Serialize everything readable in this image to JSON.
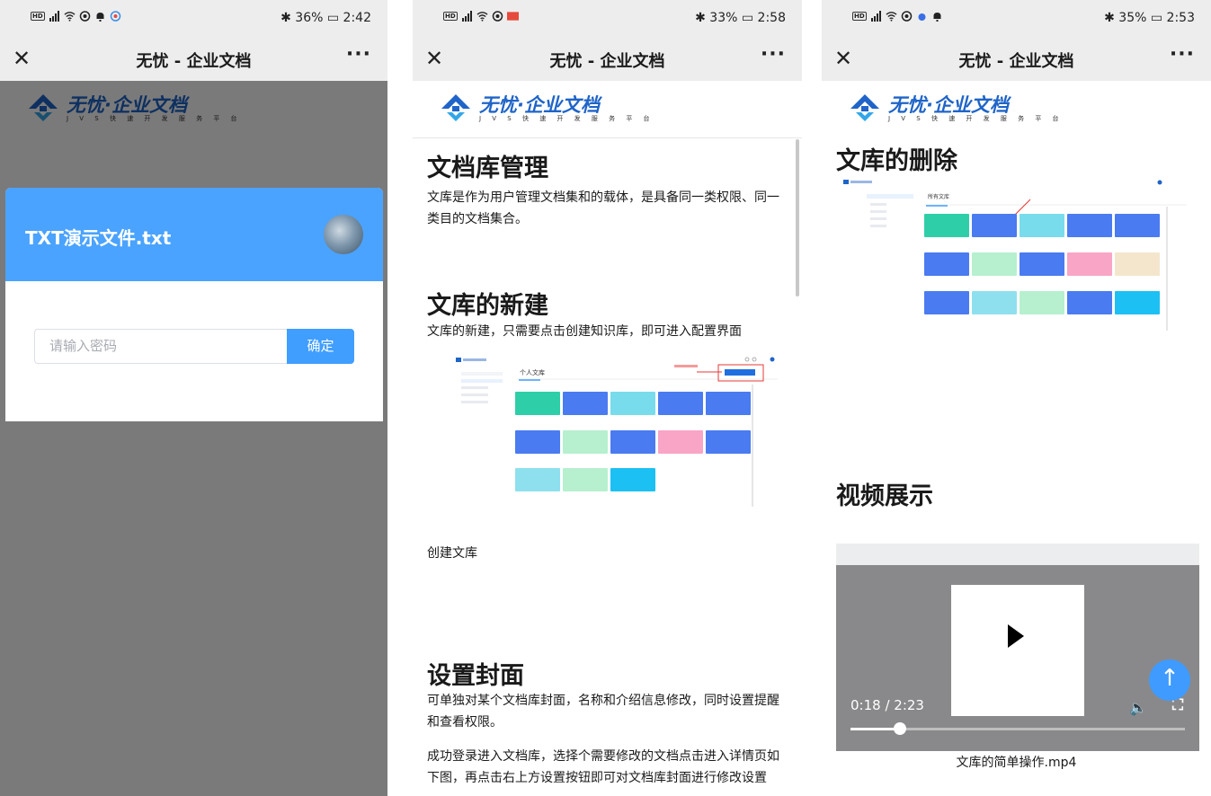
{
  "app_title": "无忧 - 企业文档",
  "status": {
    "p1": {
      "battery": "36%",
      "time": "2:42"
    },
    "p2": {
      "battery": "33%",
      "time": "2:58"
    },
    "p3": {
      "battery": "35%",
      "time": "2:53"
    }
  },
  "logo": {
    "name": "无忧·企业文档",
    "tagline": "J V S 快 速 开 发 服 务 平 台"
  },
  "dialog": {
    "file_name": "TXT演示文件.txt",
    "password_placeholder": "请输入密码",
    "confirm_label": "确定"
  },
  "doc": {
    "section1_title": "文档库管理",
    "section1_text": "文库是作为用户管理文档集和的载体，是具备同一类权限、同一类目的文档集合。",
    "section2_title": "文库的新建",
    "section2_text": "文库的新建，只需要点击创建知识库，即可进入配置界面",
    "section2_caption": "创建文库",
    "section3_title": "设置封面",
    "section3_text": "可单独对某个文档库封面，名称和介绍信息修改，同时设置提醒和查看权限。",
    "section3_text2": "成功登录进入文档库，选择个需要修改的文档点击进入详情页如下图，再点击右上方设置按钮即可对文档库封面进行修改设置",
    "delete_title": "文库的删除",
    "video_title": "视频展示",
    "video_caption": "文库的简单操作.mp4"
  },
  "screenshot": {
    "tab_personal": "个人文库",
    "tab_all": "所有文库"
  },
  "video": {
    "time": "0:18 / 2:23",
    "progress": 0.148
  },
  "colors": {
    "primary": "#409eff",
    "header_blue": "#4aa3ff",
    "logo_blue": "#1f64c8"
  },
  "icons": [
    "close-icon",
    "more-icon",
    "play-icon",
    "volume-icon",
    "fullscreen-icon",
    "back-to-top-icon",
    "signal-icon",
    "wifi-icon",
    "battery-icon",
    "bluetooth-icon"
  ]
}
